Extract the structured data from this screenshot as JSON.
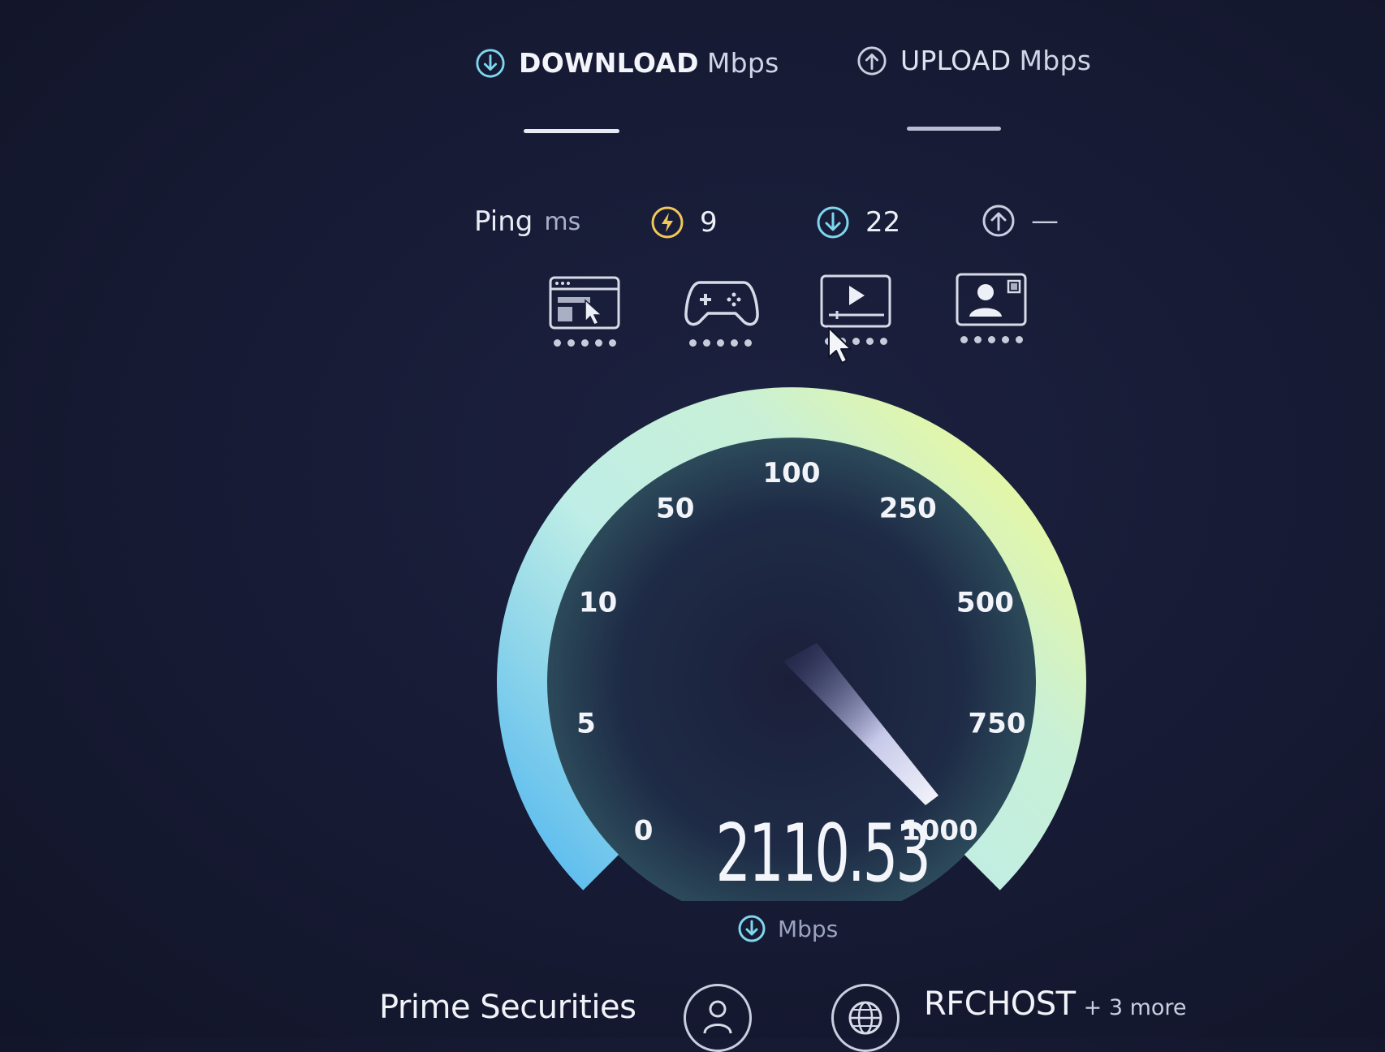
{
  "tabs": {
    "download": {
      "label": "DOWNLOAD",
      "unit": "Mbps"
    },
    "upload": {
      "label": "UPLOAD",
      "unit": "Mbps"
    }
  },
  "ping": {
    "label": "Ping",
    "unit": "ms",
    "idle_value": "9",
    "download_value": "22",
    "upload_value": "—"
  },
  "activities": [
    {
      "icon": "web-browsing-icon",
      "rating": 5
    },
    {
      "icon": "gaming-icon",
      "rating": 5
    },
    {
      "icon": "video-streaming-icon",
      "rating": 5
    },
    {
      "icon": "video-call-icon",
      "rating": 5
    }
  ],
  "gauge": {
    "ticks": [
      "0",
      "5",
      "10",
      "50",
      "100",
      "250",
      "500",
      "750",
      "1000"
    ],
    "value": "2110.53",
    "unit": "Mbps",
    "colors": {
      "start": "#5fc3ef",
      "mid": "#bfeee0",
      "end": "#e6f7a6"
    }
  },
  "servers": {
    "provider": "Prime Securities",
    "host": "RFCHOST",
    "host_more": "+ 3 more"
  }
}
